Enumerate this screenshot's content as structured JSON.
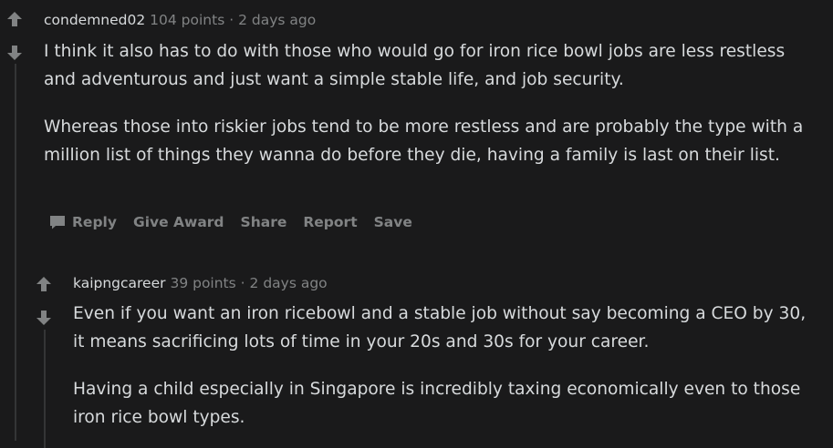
{
  "comments": [
    {
      "author": "condemned02",
      "points": "104 points",
      "separator": "·",
      "time": "2 days ago",
      "paragraphs": [
        "I think it also has to do with those who would go for iron rice bowl jobs are less restless and adventurous and just want a simple stable life, and job security.",
        "Whereas those into riskier jobs tend to be more restless and are probably the type with a million list of things they wanna do before they die, having a family is last on their list."
      ],
      "actions": {
        "reply": "Reply",
        "give_award": "Give Award",
        "share": "Share",
        "report": "Report",
        "save": "Save"
      }
    },
    {
      "author": "kaipngcareer",
      "points": "39 points",
      "separator": "·",
      "time": "2 days ago",
      "paragraphs": [
        "Even if you want an iron ricebowl and a stable job without say becoming a CEO by 30, it means sacrificing lots of time in your 20s and 30s for your career.",
        "Having a child especially in Singapore is incredibly taxing economically even to those iron rice bowl types."
      ]
    }
  ],
  "icons": {
    "upvote": "upvote-arrow-icon",
    "downvote": "downvote-arrow-icon",
    "reply": "speech-bubble-icon"
  },
  "colors": {
    "background": "#1a1a1b",
    "text": "#d7dadc",
    "muted": "#818384",
    "thread_line": "#343536"
  }
}
